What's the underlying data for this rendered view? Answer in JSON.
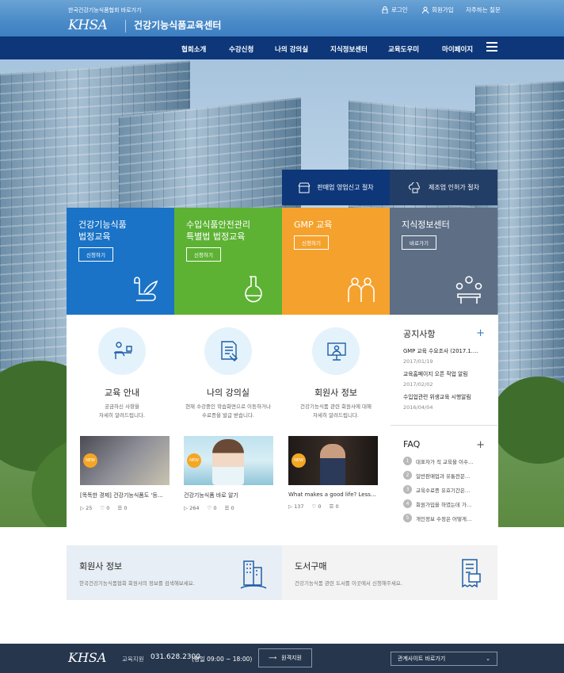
{
  "header": {
    "ksha_link": "한국건강기능식품협회 바로가기",
    "login": "로그인",
    "signup": "회원가입",
    "faq_link": "자주하는 질문",
    "logo": "KHSA",
    "center_name": "건강기능식품교육센터"
  },
  "nav": [
    "협회소개",
    "수강신청",
    "나의 강의실",
    "지식정보센터",
    "교육도우미",
    "마이페이지"
  ],
  "quick": [
    {
      "label": "판매업 영업신고 절차",
      "icon": "store-icon"
    },
    {
      "label": "제조업 인허가 절차",
      "icon": "cloud-building-icon"
    }
  ],
  "tiles": [
    {
      "title": "건강기능식품\n법정교육",
      "button": "신청하기",
      "color": "#1a73c6",
      "icon": "scroll-feather-icon"
    },
    {
      "title": "수입식품안전관리\n특별법 법정교육",
      "button": "신청하기",
      "color": "#5db234",
      "icon": "flask-icon"
    },
    {
      "title": "GMP 교육",
      "button": "신청하기",
      "color": "#f4a22d",
      "icon": "people-icon"
    },
    {
      "title": "지식정보센터",
      "button": "바로가기",
      "color": "#5d6e85",
      "icon": "meeting-icon"
    }
  ],
  "services": [
    {
      "title": "교육 안내",
      "desc": "궁금하신 사항을\n자세히 알려드립니다.",
      "icon": "desk-person-icon"
    },
    {
      "title": "나의 강의실",
      "desc": "현재 수강중인 학습화면으로 이동하거나\n수료증을 발급 받습니다.",
      "icon": "certificate-icon"
    },
    {
      "title": "회원사 정보",
      "desc": "건강기능식품 관련 회원사에 대해\n자세히 알려드립니다.",
      "icon": "monitor-person-icon"
    }
  ],
  "videos": [
    {
      "title": "[똑똑한 경제] 건강기능식품도 '등…",
      "badge": "NEW",
      "views": "25",
      "likes": "0",
      "comments": "0"
    },
    {
      "title": "건강기능식품 바로 알기",
      "badge": "NEW",
      "views": "264",
      "likes": "0",
      "comments": "0"
    },
    {
      "title": "What makes a good life? Less…",
      "badge": "NEW",
      "views": "137",
      "likes": "0",
      "comments": "0"
    }
  ],
  "notice": {
    "title": "공지사항",
    "items": [
      {
        "title": "GMP 교육 수요조사 (2017.1.…",
        "date": "2017/01/19"
      },
      {
        "title": "교육홈페이지 오픈 작업 알림",
        "date": "2017/02/02"
      },
      {
        "title": "수입업관련 위생교육 시행알림",
        "date": "2016/04/04"
      }
    ]
  },
  "faq": {
    "title": "FAQ",
    "items": [
      "대표자가 직 교육을 이수…",
      "일반판매업과 유통전문…",
      "교육수료증 유효기간은…",
      "회원가입을 하였는데 가…",
      "개인정보 수정은 어떻게…"
    ]
  },
  "bottom": {
    "member_title": "회원사 정보",
    "member_desc": "한국건강기능식품협회 회원사의 정보를 검색해보세요.",
    "books_title": "도서구매",
    "books_desc": "건강기능식품 관련 도서를 이곳에서 신청해주세요."
  },
  "footer": {
    "logo": "KHSA",
    "branch": "교육지원",
    "phone": "031.628.2300",
    "hours": "(평일 09:00 ~ 18:00)",
    "remote": "원격지원",
    "related": "관계사이트 바로가기"
  }
}
